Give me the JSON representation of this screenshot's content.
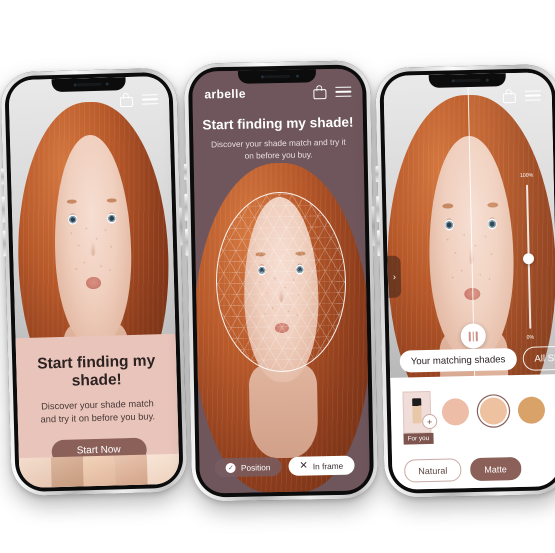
{
  "background_color": "#ffffff",
  "theme": {
    "accent_mauve": "#8b6059",
    "panel_pink": "#e9c4ba",
    "screen2_plum": "#6e565c",
    "tray_white": "#ffffff",
    "badge_brown": "#7e544e"
  },
  "phone1": {
    "name": "onboarding-screen",
    "topbar": {
      "bag_icon": "shopping-bag-icon",
      "menu_icon": "hamburger-menu-icon"
    },
    "heading": "Start finding my shade!",
    "subtext": "Discover your shade match and try it on before you buy.",
    "cta_label": "Start Now",
    "strip_thumbs": [
      "#e7c7b4",
      "#d9b49c",
      "#efcdb4",
      "#e3bda6",
      "#f2dccb"
    ]
  },
  "phone2": {
    "name": "face-scan-screen",
    "brand": "arbelle",
    "topbar": {
      "bag_icon": "shopping-bag-icon",
      "menu_icon": "hamburger-menu-icon"
    },
    "heading": "Start finding my shade!",
    "subtext": "Discover your shade match and try it on before you buy.",
    "status_pills": [
      {
        "label": "Position",
        "icon": "check-circle-icon",
        "state": "done"
      },
      {
        "label": "In frame",
        "icon": "close-x-icon",
        "state": "pending"
      }
    ]
  },
  "phone3": {
    "name": "try-on-result-screen",
    "topbar": {
      "bag_icon": "shopping-bag-icon",
      "menu_icon": "hamburger-menu-icon"
    },
    "side_tab_icon": "chevron-right-icon",
    "split_handle_icon": "split-compare-handle-icon",
    "intensity_slider": {
      "max_label": "100%",
      "min_label": "0%",
      "value": 56
    },
    "buttons": [
      {
        "label": "Your matching shades",
        "style": "filled"
      },
      {
        "label": "All Shades",
        "style": "outline"
      }
    ],
    "product": {
      "badge": "For you",
      "add_icon": "plus-icon",
      "thumb_name": "foundation-bottle"
    },
    "shades": [
      {
        "hex": "#eebda8",
        "selected": false
      },
      {
        "hex": "#eec2a0",
        "selected": true
      },
      {
        "hex": "#d8a268",
        "selected": false
      }
    ],
    "finishes": [
      {
        "label": "Natural",
        "selected": false
      },
      {
        "label": "Matte",
        "selected": true
      }
    ]
  }
}
